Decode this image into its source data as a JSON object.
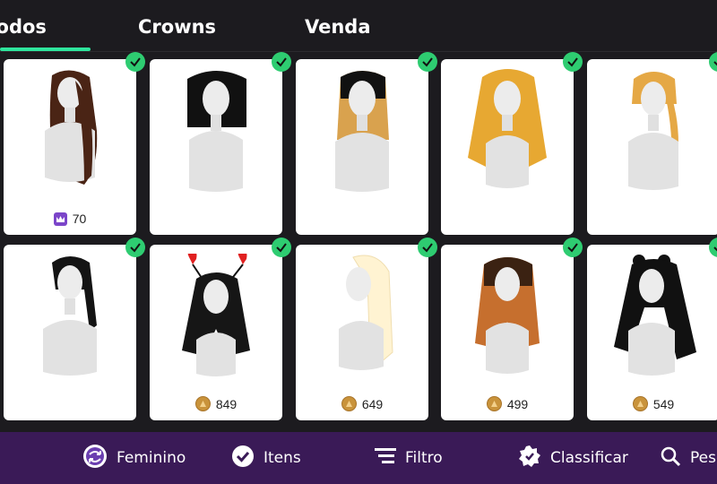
{
  "tabs": [
    {
      "label": "Todos",
      "active": true
    },
    {
      "label": "Crowns",
      "active": false
    },
    {
      "label": "Venda",
      "active": false
    }
  ],
  "items_row1": [
    {
      "price": "70",
      "currency": "crown-icon",
      "hair": "#4a2415",
      "owned": true
    },
    {
      "price": "",
      "currency": "",
      "hair": "#111111",
      "owned": true
    },
    {
      "price": "",
      "currency": "",
      "hair": "#111111",
      "owned": true
    },
    {
      "price": "",
      "currency": "",
      "hair": "#e7a832",
      "owned": true
    },
    {
      "price": "",
      "currency": "",
      "hair": "#e5a845",
      "owned": true
    }
  ],
  "items_row2": [
    {
      "price": "",
      "currency": "",
      "hair": "#141414",
      "owned": true
    },
    {
      "price": "849",
      "currency": "coin-icon",
      "hair": "#161616",
      "owned": true
    },
    {
      "price": "649",
      "currency": "coin-icon",
      "hair": "#fff3d2",
      "owned": true
    },
    {
      "price": "499",
      "currency": "coin-icon",
      "hair": "#c66f2e",
      "owned": true
    },
    {
      "price": "549",
      "currency": "coin-icon",
      "hair": "#111111",
      "owned": true
    }
  ],
  "bottom_bar": {
    "feminino": "Feminino",
    "itens": "Itens",
    "filtro": "Filtro",
    "classificar": "Classificar",
    "pesquisar": "Pesq"
  },
  "colors": {
    "accent": "#2ee59d",
    "check": "#2ecc71",
    "bottom_bg": "#3a1a57",
    "coin": "#c9933b",
    "crown": "#7b45c9"
  }
}
